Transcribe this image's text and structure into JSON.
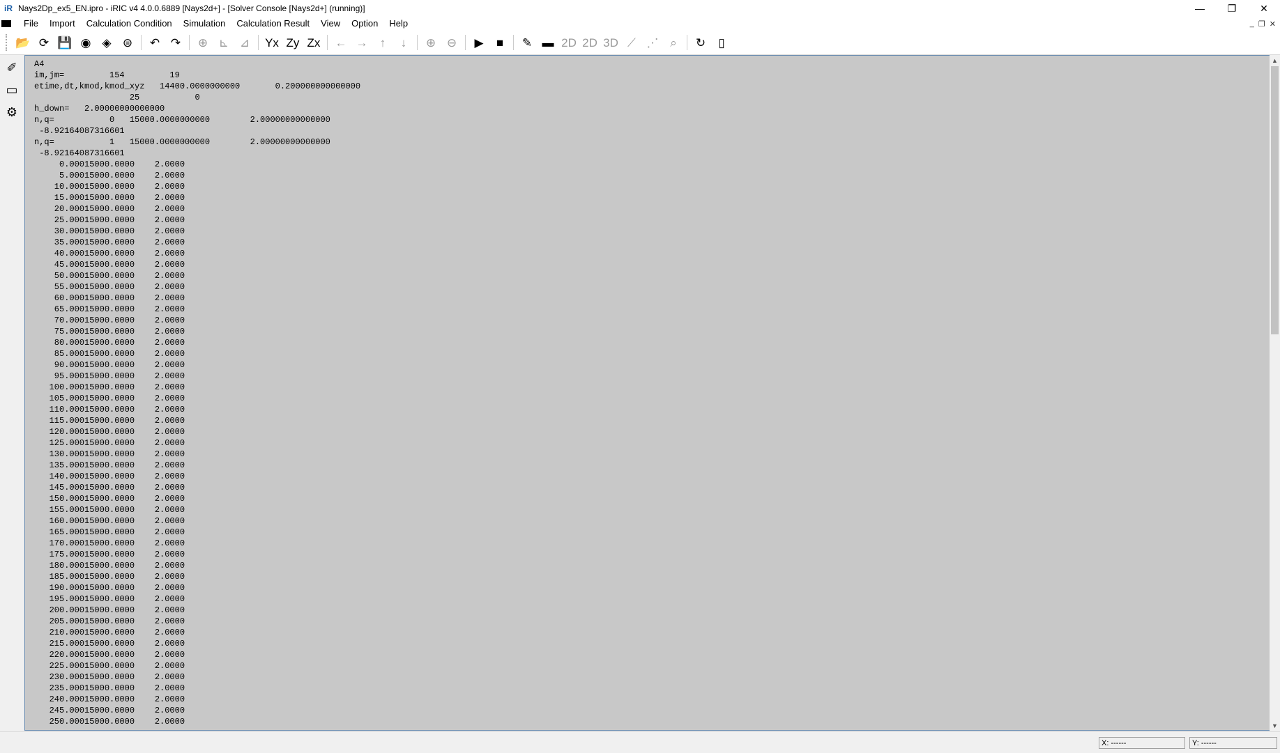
{
  "window": {
    "title": "Nays2Dp_ex5_EN.ipro - iRIC v4 4.0.0.6889 [Nays2d+] - [Solver Console [Nays2d+] (running)]",
    "minimize": "—",
    "restore": "❐",
    "close": "✕"
  },
  "menu": {
    "items": [
      "File",
      "Import",
      "Calculation Condition",
      "Simulation",
      "Calculation Result",
      "View",
      "Option",
      "Help"
    ],
    "mdi": [
      "_",
      "❐",
      "✕"
    ]
  },
  "toolbar": {
    "buttons": [
      {
        "name": "open-project-icon",
        "glyph": "📂",
        "disabled": false
      },
      {
        "name": "reload-icon",
        "glyph": "⟳",
        "disabled": false
      },
      {
        "name": "save-icon",
        "glyph": "💾",
        "disabled": false
      },
      {
        "name": "snapshot-icon",
        "glyph": "◉",
        "disabled": false
      },
      {
        "name": "snapshot-continuous-icon",
        "glyph": "◈",
        "disabled": false
      },
      {
        "name": "globe-icon",
        "glyph": "⊜",
        "disabled": false
      },
      {
        "name": "sep"
      },
      {
        "name": "undo-icon",
        "glyph": "↶",
        "disabled": false
      },
      {
        "name": "redo-icon",
        "glyph": "↷",
        "disabled": false
      },
      {
        "name": "sep"
      },
      {
        "name": "fit-view-icon",
        "glyph": "⊕",
        "disabled": true
      },
      {
        "name": "axis-x-icon",
        "glyph": "⊾",
        "disabled": true
      },
      {
        "name": "axis-xy-icon",
        "glyph": "⊿",
        "disabled": true
      },
      {
        "name": "sep"
      },
      {
        "name": "view-yx-icon",
        "glyph": "Yx",
        "disabled": false
      },
      {
        "name": "view-zy-icon",
        "glyph": "Zy",
        "disabled": false
      },
      {
        "name": "view-zx-icon",
        "glyph": "Zx",
        "disabled": false
      },
      {
        "name": "sep"
      },
      {
        "name": "move-left-icon",
        "glyph": "←",
        "disabled": true
      },
      {
        "name": "move-right-icon",
        "glyph": "→",
        "disabled": true
      },
      {
        "name": "move-up-icon",
        "glyph": "↑",
        "disabled": true
      },
      {
        "name": "move-down-icon",
        "glyph": "↓",
        "disabled": true
      },
      {
        "name": "sep"
      },
      {
        "name": "zoom-in-icon",
        "glyph": "⊕",
        "disabled": true
      },
      {
        "name": "zoom-out-icon",
        "glyph": "⊖",
        "disabled": true
      },
      {
        "name": "sep"
      },
      {
        "name": "run-icon",
        "glyph": "▶",
        "disabled": false
      },
      {
        "name": "stop-icon",
        "glyph": "■",
        "disabled": false
      },
      {
        "name": "sep"
      },
      {
        "name": "pencil-icon",
        "glyph": "✎",
        "disabled": false
      },
      {
        "name": "console-icon",
        "glyph": "▬",
        "disabled": false
      },
      {
        "name": "post-2d-icon",
        "glyph": "2D",
        "disabled": true
      },
      {
        "name": "post-2d-bird-icon",
        "glyph": "2D",
        "disabled": true
      },
      {
        "name": "post-3d-icon",
        "glyph": "3D",
        "disabled": true
      },
      {
        "name": "graph-icon",
        "glyph": "⟋",
        "disabled": true
      },
      {
        "name": "scatter-icon",
        "glyph": "⋰",
        "disabled": true
      },
      {
        "name": "chart-zoom-icon",
        "glyph": "⌕",
        "disabled": true
      },
      {
        "name": "sep"
      },
      {
        "name": "refresh-icon",
        "glyph": "↻",
        "disabled": false
      },
      {
        "name": "mouse-icon",
        "glyph": "▯",
        "disabled": false
      }
    ]
  },
  "sidebar": {
    "buttons": [
      {
        "name": "pre-processor-icon",
        "glyph": "✐"
      },
      {
        "name": "solver-console-icon",
        "glyph": "▭"
      },
      {
        "name": "post-processor-icon",
        "glyph": "⚙"
      }
    ]
  },
  "console": {
    "header_lines": [
      "A4",
      "im,jm=         154         19",
      "etime,dt,kmod,kmod_xyz   14400.0000000000       0.200000000000000",
      "                   25           0",
      "h_down=   2.00000000000000",
      "n,q=           0   15000.0000000000        2.00000000000000",
      " -8.92164087316601",
      "n,q=           1   15000.0000000000        2.00000000000000",
      " -8.92164087316601"
    ],
    "rows": [
      {
        "t": "0.000",
        "q": "15000.0000",
        "h": "2.0000"
      },
      {
        "t": "5.000",
        "q": "15000.0000",
        "h": "2.0000"
      },
      {
        "t": "10.000",
        "q": "15000.0000",
        "h": "2.0000"
      },
      {
        "t": "15.000",
        "q": "15000.0000",
        "h": "2.0000"
      },
      {
        "t": "20.000",
        "q": "15000.0000",
        "h": "2.0000"
      },
      {
        "t": "25.000",
        "q": "15000.0000",
        "h": "2.0000"
      },
      {
        "t": "30.000",
        "q": "15000.0000",
        "h": "2.0000"
      },
      {
        "t": "35.000",
        "q": "15000.0000",
        "h": "2.0000"
      },
      {
        "t": "40.000",
        "q": "15000.0000",
        "h": "2.0000"
      },
      {
        "t": "45.000",
        "q": "15000.0000",
        "h": "2.0000"
      },
      {
        "t": "50.000",
        "q": "15000.0000",
        "h": "2.0000"
      },
      {
        "t": "55.000",
        "q": "15000.0000",
        "h": "2.0000"
      },
      {
        "t": "60.000",
        "q": "15000.0000",
        "h": "2.0000"
      },
      {
        "t": "65.000",
        "q": "15000.0000",
        "h": "2.0000"
      },
      {
        "t": "70.000",
        "q": "15000.0000",
        "h": "2.0000"
      },
      {
        "t": "75.000",
        "q": "15000.0000",
        "h": "2.0000"
      },
      {
        "t": "80.000",
        "q": "15000.0000",
        "h": "2.0000"
      },
      {
        "t": "85.000",
        "q": "15000.0000",
        "h": "2.0000"
      },
      {
        "t": "90.000",
        "q": "15000.0000",
        "h": "2.0000"
      },
      {
        "t": "95.000",
        "q": "15000.0000",
        "h": "2.0000"
      },
      {
        "t": "100.000",
        "q": "15000.0000",
        "h": "2.0000"
      },
      {
        "t": "105.000",
        "q": "15000.0000",
        "h": "2.0000"
      },
      {
        "t": "110.000",
        "q": "15000.0000",
        "h": "2.0000"
      },
      {
        "t": "115.000",
        "q": "15000.0000",
        "h": "2.0000"
      },
      {
        "t": "120.000",
        "q": "15000.0000",
        "h": "2.0000"
      },
      {
        "t": "125.000",
        "q": "15000.0000",
        "h": "2.0000"
      },
      {
        "t": "130.000",
        "q": "15000.0000",
        "h": "2.0000"
      },
      {
        "t": "135.000",
        "q": "15000.0000",
        "h": "2.0000"
      },
      {
        "t": "140.000",
        "q": "15000.0000",
        "h": "2.0000"
      },
      {
        "t": "145.000",
        "q": "15000.0000",
        "h": "2.0000"
      },
      {
        "t": "150.000",
        "q": "15000.0000",
        "h": "2.0000"
      },
      {
        "t": "155.000",
        "q": "15000.0000",
        "h": "2.0000"
      },
      {
        "t": "160.000",
        "q": "15000.0000",
        "h": "2.0000"
      },
      {
        "t": "165.000",
        "q": "15000.0000",
        "h": "2.0000"
      },
      {
        "t": "170.000",
        "q": "15000.0000",
        "h": "2.0000"
      },
      {
        "t": "175.000",
        "q": "15000.0000",
        "h": "2.0000"
      },
      {
        "t": "180.000",
        "q": "15000.0000",
        "h": "2.0000"
      },
      {
        "t": "185.000",
        "q": "15000.0000",
        "h": "2.0000"
      },
      {
        "t": "190.000",
        "q": "15000.0000",
        "h": "2.0000"
      },
      {
        "t": "195.000",
        "q": "15000.0000",
        "h": "2.0000"
      },
      {
        "t": "200.000",
        "q": "15000.0000",
        "h": "2.0000"
      },
      {
        "t": "205.000",
        "q": "15000.0000",
        "h": "2.0000"
      },
      {
        "t": "210.000",
        "q": "15000.0000",
        "h": "2.0000"
      },
      {
        "t": "215.000",
        "q": "15000.0000",
        "h": "2.0000"
      },
      {
        "t": "220.000",
        "q": "15000.0000",
        "h": "2.0000"
      },
      {
        "t": "225.000",
        "q": "15000.0000",
        "h": "2.0000"
      },
      {
        "t": "230.000",
        "q": "15000.0000",
        "h": "2.0000"
      },
      {
        "t": "235.000",
        "q": "15000.0000",
        "h": "2.0000"
      },
      {
        "t": "240.000",
        "q": "15000.0000",
        "h": "2.0000"
      },
      {
        "t": "245.000",
        "q": "15000.0000",
        "h": "2.0000"
      },
      {
        "t": "250.000",
        "q": "15000.0000",
        "h": "2.0000"
      }
    ]
  },
  "status": {
    "x": "X: ------",
    "y": "Y: ------"
  }
}
